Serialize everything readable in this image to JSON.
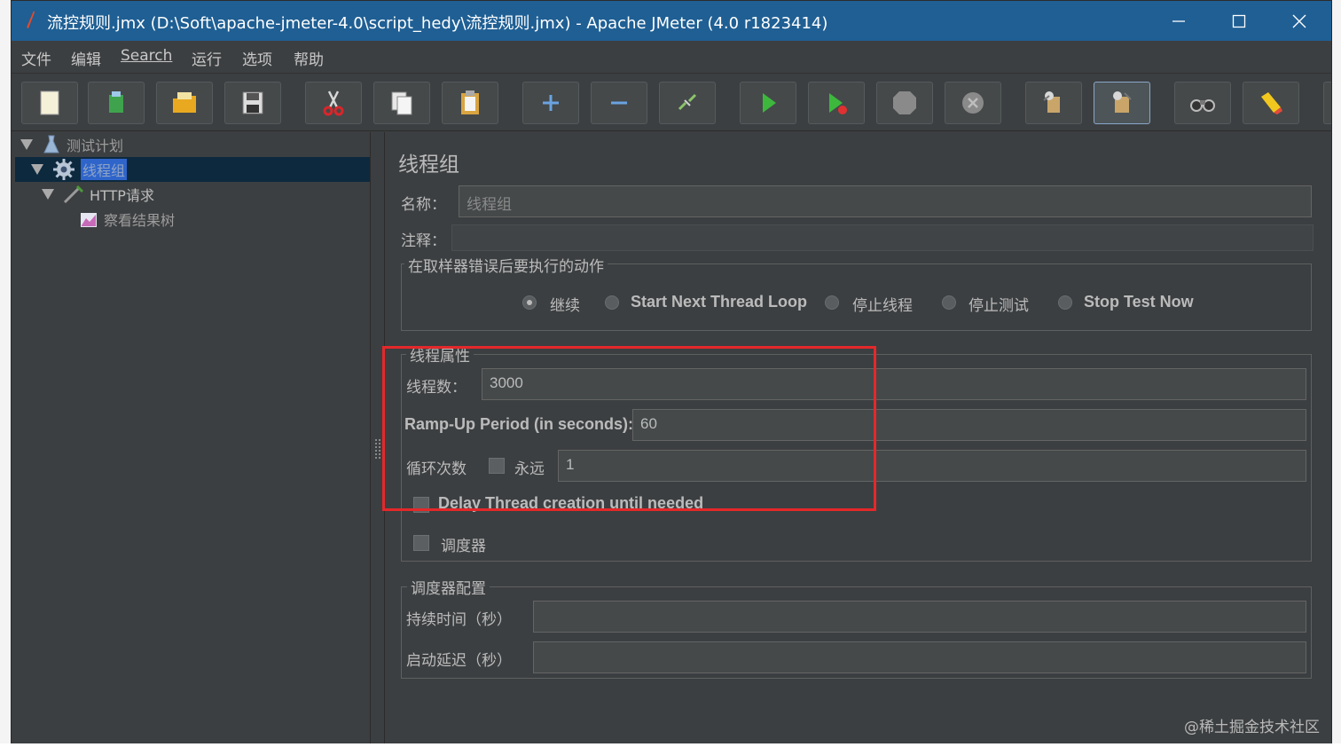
{
  "window": {
    "title": "流控规则.jmx (D:\\Soft\\apache-jmeter-4.0\\script_hedy\\流控规则.jmx) - Apache JMeter (4.0 r1823414)"
  },
  "menu": [
    "文件",
    "编辑",
    "Search",
    "运行",
    "选项",
    "帮助"
  ],
  "toolbar": {
    "buttons": [
      "new-icon",
      "templates-icon",
      "open-icon",
      "save-icon",
      "cut-icon",
      "copy-icon",
      "paste-icon",
      "expand-icon",
      "collapse-icon",
      "toggle-icon",
      "start-icon",
      "start-no-pause-icon",
      "stop-icon",
      "shutdown-icon",
      "clear-icon",
      "clear-all-icon",
      "search-icon",
      "reset-search-icon"
    ]
  },
  "tree": {
    "items": [
      {
        "label": "测试计划",
        "icon": "test-plan-icon"
      },
      {
        "label": "线程组",
        "icon": "thread-group-gear-icon",
        "selected": true
      },
      {
        "label": "HTTP请求",
        "icon": "http-sampler-icon"
      },
      {
        "label": "察看结果树",
        "icon": "result-tree-icon"
      }
    ]
  },
  "panel": {
    "title": "线程组",
    "name_label": "名称：",
    "name_value": "线程组",
    "comment_label": "注释：",
    "comment_value": "",
    "error_action": {
      "legend": "在取样器错误后要执行的动作",
      "options": [
        "继续",
        "Start Next Thread Loop",
        "停止线程",
        "停止测试",
        "Stop Test Now"
      ],
      "selected": "继续"
    },
    "thread_props": {
      "legend": "线程属性",
      "threads_label": "线程数：",
      "threads_value": "3000",
      "rampup_label": "Ramp-Up Period (in seconds):",
      "rampup_value": "60",
      "loop_label": "循环次数",
      "forever_label": "永远",
      "loop_value": "1",
      "delay_label": "Delay Thread creation until needed",
      "scheduler_label": "调度器"
    },
    "scheduler": {
      "legend": "调度器配置",
      "duration_label": "持续时间（秒）",
      "duration_value": "",
      "delay_label": "启动延迟（秒）",
      "delay_value": ""
    }
  },
  "watermark": "@稀土掘金技术社区",
  "colors": {
    "titlebar": "#1f5f94",
    "background": "#3c3f41",
    "highlight": "#e5282a",
    "selection": "#0d293e"
  }
}
